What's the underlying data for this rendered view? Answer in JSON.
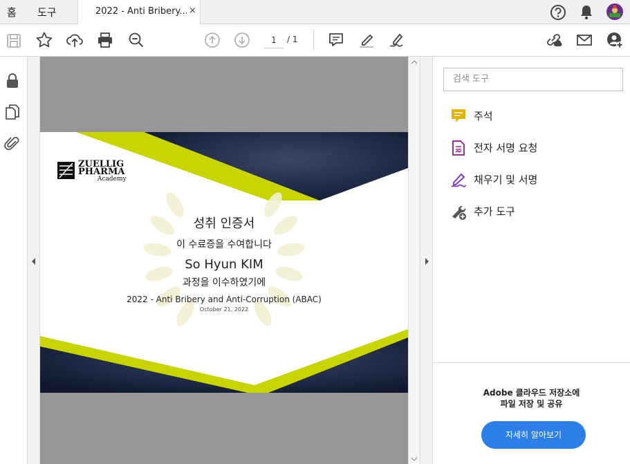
{
  "tabs": {
    "home": "홈",
    "tools": "도구",
    "doc_title": "2022 - Anti Bribery...",
    "close": "×"
  },
  "toolbar": {
    "page_current": "1",
    "page_total": "/ 1"
  },
  "panel": {
    "search_placeholder": "검색 도구",
    "tools": [
      {
        "label": "주석",
        "icon": "comment-icon",
        "color": "#e0b400"
      },
      {
        "label": "전자 서명 요청",
        "icon": "request-signature-icon",
        "color": "#a12a9c"
      },
      {
        "label": "채우기 및 서명",
        "icon": "fill-sign-icon",
        "color": "#7b3fbf"
      },
      {
        "label": "추가 도구",
        "icon": "more-tools-icon",
        "color": "#555555"
      }
    ],
    "promo_line1": "Adobe 클라우드 저장소에",
    "promo_line2": "파일 저장 및 공유",
    "promo_button": "자세히 알아보기"
  },
  "certificate": {
    "logo_line1": "ZUELLIG",
    "logo_line2": "PHARMA",
    "logo_line3": "Academy",
    "heading": "성취 인증서",
    "subheading": "이 수료증을 수여합니다",
    "recipient": "So Hyun KIM",
    "completion": "과정을 이수하였기에",
    "course": "2022 - Anti Bribery and Anti-Corruption (ABAC)",
    "date": "October 21, 2022"
  },
  "colors": {
    "accent_lime": "#c8d400",
    "navy": "#16213a",
    "button_blue": "#2d7ee6"
  }
}
